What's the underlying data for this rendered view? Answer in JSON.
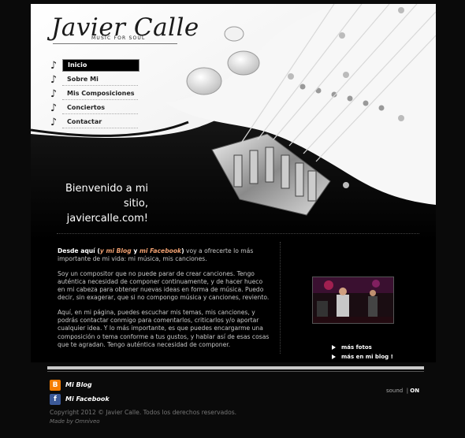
{
  "site": {
    "logo": "Javier Calle",
    "tagline": "MUSIC FOR SOUL"
  },
  "nav": {
    "items": [
      {
        "label": "Inicio"
      },
      {
        "label": "Sobre Mi"
      },
      {
        "label": "Mis Composiciones"
      },
      {
        "label": "Conciertos"
      },
      {
        "label": "Contactar"
      }
    ]
  },
  "welcome": {
    "line1": "Bienvenido a mi sitio,",
    "line2": "javiercalle.com!"
  },
  "content": {
    "p1_a": "Desde aquí (",
    "p1_blog": "y mi Blog",
    "p1_y": " y ",
    "p1_fb": "mi Facebook",
    "p1_b": ")",
    "p1_rest": " voy a ofrecerte lo más importante de mi vida: mi música, mis canciones.",
    "p2": "Soy un compositor que no puede parar de crear canciones. Tengo auténtica necesidad de componer continuamente, y de hacer hueco en mi cabeza para obtener nuevas ideas en forma de música. Puedo decir, sin exagerar, que si no compongo música y canciones, reviento.",
    "p3": "Aquí, en mi página, puedes escuchar mis temas, mis canciones, y podrás contactar conmigo para comentarlos, criticarlos y/o aportar cualquier idea. Y lo más importante, es que puedes encargarme una composición o tema conforme a tus gustos, y hablar así de esas cosas que te agradan. Tengo auténtica necesidad de componer."
  },
  "side_links": {
    "more_photos": "más fotos",
    "more_blog": "más en mi blog !"
  },
  "footer": {
    "blog_label": "Mi Blog",
    "facebook_label": "Mi Facebook",
    "sound_label": "sound",
    "sound_sep": "|",
    "sound_state": "ON",
    "copyright": "Copyright 2012 © Javier Calle. Todos los derechos reservados.",
    "made_by": "Made by Omniveo"
  },
  "colors": {
    "background": "#000000",
    "highlight": "#f0a070",
    "blogger": "#f57d00",
    "facebook": "#3b5998"
  },
  "icons": {
    "nav_bullet": "music-note-icon",
    "blogger": "blogger-icon",
    "facebook": "facebook-icon",
    "link_arrow": "triangle-right-icon"
  }
}
